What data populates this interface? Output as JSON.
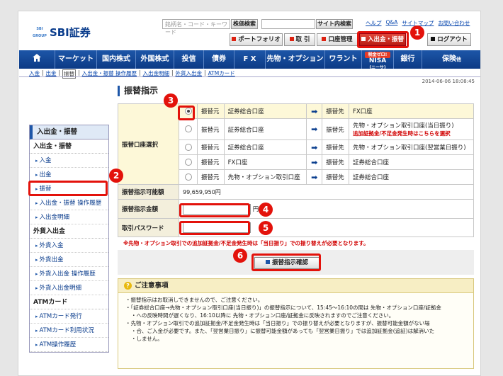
{
  "brand": {
    "logo_mark": "SBI",
    "logo_mark_sub": "GROUP",
    "name": "SBI証券"
  },
  "header": {
    "search_placeholder": "銘柄名・コード・キーワード",
    "stock_search_button": "株価検索",
    "site_search_button": "サイト内検索",
    "links": [
      "ヘルプ",
      "Q&A",
      "サイトマップ",
      "お問い合わせ"
    ],
    "tabs": [
      "ポートフォリオ",
      "取 引",
      "口座管理",
      "入出金・振替"
    ],
    "logout": "ログアウト"
  },
  "nav": {
    "items": [
      "マーケット",
      "国内株式",
      "外国株式",
      "投信",
      "債券",
      "F X",
      "先物・オプション",
      "ワラント",
      "銀行"
    ],
    "nisa_tag": "税金ゼロ!",
    "nisa_label": "NISA",
    "nisa_sub": "(ニーサ)",
    "insurance_label": "保険",
    "insurance_suffix": "他"
  },
  "subnav": {
    "items": [
      "入金",
      "出金",
      "振替",
      "入出金・振替 操作履歴",
      "入出金明細",
      "外貨入出金",
      "ATMカード"
    ],
    "current": "振替"
  },
  "timestamp": "2014-06-06 18:08:45",
  "sidebar": {
    "title": "入出金・振替",
    "section1": "入出金・振替",
    "links1": [
      "入金",
      "出金",
      "振替",
      "入出金・振替 操作履歴",
      "入出金明細"
    ],
    "section2": "外貨入出金",
    "links2": [
      "外貨入金",
      "外貨出金",
      "外貨入出金 操作履歴",
      "外貨入出金明細"
    ],
    "section3": "ATMカード",
    "links3": [
      "ATMカード発行",
      "ATMカード利用状況",
      "ATM操作履歴"
    ]
  },
  "page_title": "振替指示",
  "form": {
    "account_select_label": "振替口座選択",
    "from_label": "振替元",
    "to_label": "振替先",
    "rows": [
      {
        "from": "証券総合口座",
        "to": "FX口座",
        "note": "",
        "selected": true
      },
      {
        "from": "証券総合口座",
        "to": "先物・オプション取引口座(当日振り)",
        "note": "追加証拠金/不足金発生時はこちらを選択",
        "selected": false
      },
      {
        "from": "証券総合口座",
        "to": "先物・オプション取引口座(翌営業日振り)",
        "note": "",
        "selected": false
      },
      {
        "from": "FX口座",
        "to": "証券総合口座",
        "note": "",
        "selected": false
      },
      {
        "from": "先物・オプション取引口座",
        "to": "証券総合口座",
        "note": "",
        "selected": false
      }
    ],
    "available_label": "振替指示可能額",
    "available_value": "99,659,950円",
    "amount_label": "振替指示金額",
    "amount_unit": "円",
    "password_label": "取引パスワード",
    "warning": "※先物・オプション取引での追加証拠金/不足金発生時は「当日振り」での振り替えが必要となります。",
    "confirm_button": "振替指示確認"
  },
  "notice": {
    "title": "ご注意事項",
    "icon": "?",
    "items": [
      "振替指示はお取消しできませんので、ご注意ください。",
      "「証券総合口座→先物・オプション取引口座(当日振り)」の振替指示について、15:45～16:10の間は 先物・オプション口座/証拠金",
      "への反映時間が遅くなり、16:10以降に 先物・オプション口座/証拠金に反映されますのでご注意ください。",
      "先物・オプション取引での追加証拠金/不足金発生時は「当日振り」での振り替えが必要となりますが、振替可能金額がない場",
      "合、ご入金が必要です。また、「翌営業日振り」に振替可能金額があっても「翌営業日振り」では追加証拠金(追証)は解消いた",
      "しません。"
    ]
  },
  "annotations": [
    "1",
    "2",
    "3",
    "4",
    "5",
    "6"
  ],
  "colors": {
    "nav_blue": "#1d56a8",
    "highlight_red": "#e3120b",
    "active_tab": "#c8261b"
  }
}
